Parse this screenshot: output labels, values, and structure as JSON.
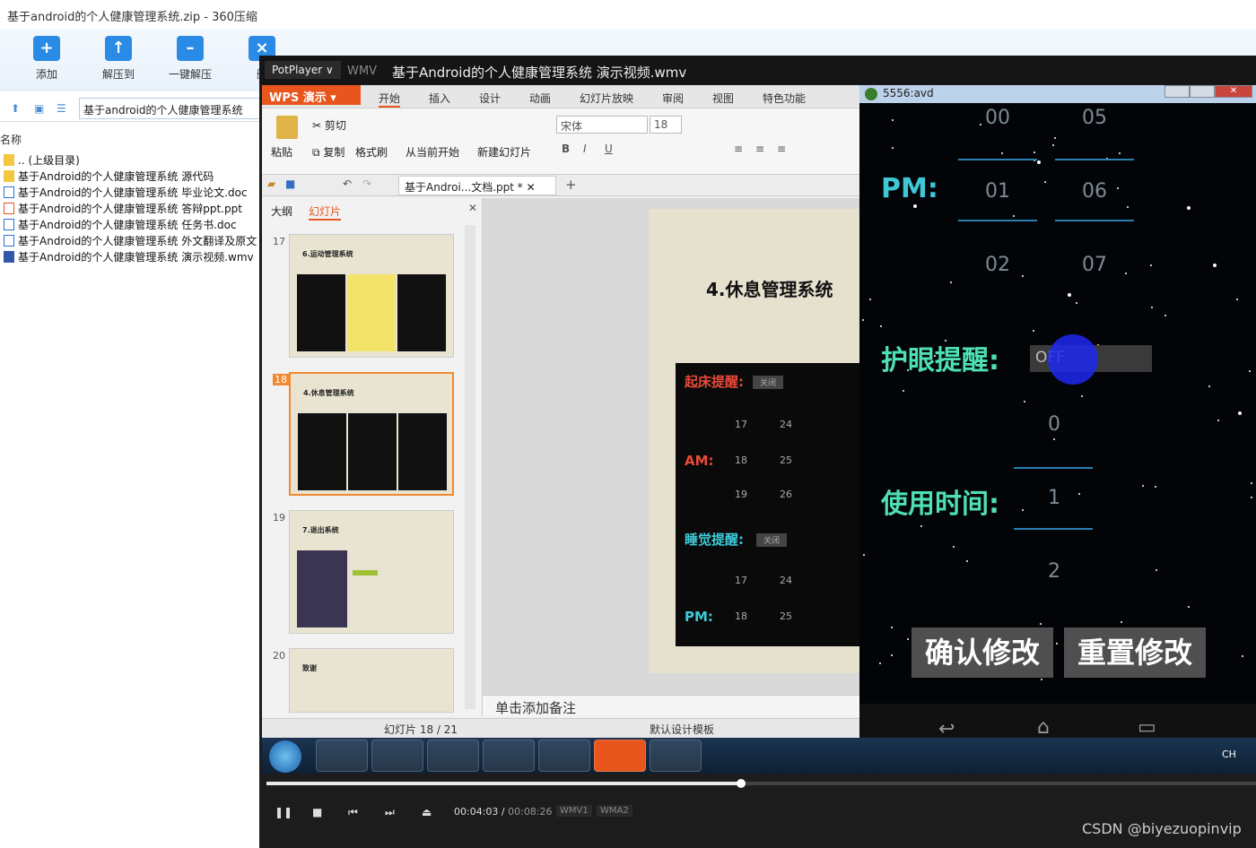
{
  "zip": {
    "title": "基于android的个人健康管理系统.zip - 360压缩",
    "toolbar": [
      "添加",
      "解压到",
      "一键解压",
      "删"
    ],
    "path": "基于android的个人健康管理系统",
    "column_name": "名称",
    "files": [
      {
        "name": ".. (上级目录)",
        "icon": "folder-icon"
      },
      {
        "name": "基于Android的个人健康管理系统 源代码",
        "icon": "folder-icon"
      },
      {
        "name": "基于Android的个人健康管理系统 毕业论文.doc",
        "icon": "doc-icon"
      },
      {
        "name": "基于Android的个人健康管理系统 答辩ppt.ppt",
        "icon": "ppt-icon"
      },
      {
        "name": "基于Android的个人健康管理系统 任务书.doc",
        "icon": "doc-icon"
      },
      {
        "name": "基于Android的个人健康管理系统 外文翻译及原文",
        "icon": "doc-icon"
      },
      {
        "name": "基于Android的个人健康管理系统 演示视频.wmv",
        "icon": "wmv-icon"
      }
    ]
  },
  "player": {
    "menu": "PotPlayer ∨",
    "format": "WMV",
    "title": "基于Android的个人健康管理系统 演示视频.wmv",
    "time_current": "00:04:03",
    "time_total": "00:08:26",
    "codecs": [
      "WMV1",
      "WMA2"
    ],
    "progress": 0.48
  },
  "wps": {
    "logo": "WPS 演示 ▾",
    "menu": [
      "开始",
      "插入",
      "设计",
      "动画",
      "幻灯片放映",
      "审阅",
      "视图",
      "特色功能"
    ],
    "ribbon": {
      "paste": "粘贴",
      "cut": "剪切",
      "copy": "复制",
      "format_painter": "格式刷",
      "from_current": "从当前开始",
      "new_slide": "新建幻灯片",
      "font": "宋体",
      "font_size": "18"
    },
    "doc_tab": "基于Androi...文档.ppt *",
    "panel_tabs": [
      "大纲",
      "幻灯片"
    ],
    "thumbs": [
      {
        "num": "17",
        "title": "6.运动管理系统"
      },
      {
        "num": "18",
        "title": "4.休息管理系统"
      },
      {
        "num": "19",
        "title": "7.退出系统"
      },
      {
        "num": "20",
        "title": "致谢"
      }
    ],
    "slide_title": "4.休息管理系统",
    "slide_content": {
      "wake": "起床提醒:",
      "off": "关闭",
      "am": "AM:",
      "sleep": "睡觉提醒:",
      "pm": "PM:",
      "nums": [
        "17",
        "24",
        "18",
        "25",
        "19",
        "26",
        "17",
        "24",
        "18",
        "25"
      ]
    },
    "notes": "单击添加备注",
    "status_slide": "幻灯片 18 / 21",
    "status_template": "默认设计模板"
  },
  "avd": {
    "title": "5556:avd",
    "top_nums": [
      "00",
      "05"
    ],
    "pm_label": "PM:",
    "pm_nums": [
      "01",
      "06"
    ],
    "mid_nums": [
      "02",
      "07"
    ],
    "eye_label": "护眼提醒:",
    "toggle": "OFF",
    "use_nums": [
      "0",
      "1",
      "2"
    ],
    "use_label": "使用时间:",
    "confirm": "确认修改",
    "reset": "重置修改"
  },
  "taskbar": {
    "lang": "CH"
  },
  "watermark": "CSDN @biyezuopinvip"
}
